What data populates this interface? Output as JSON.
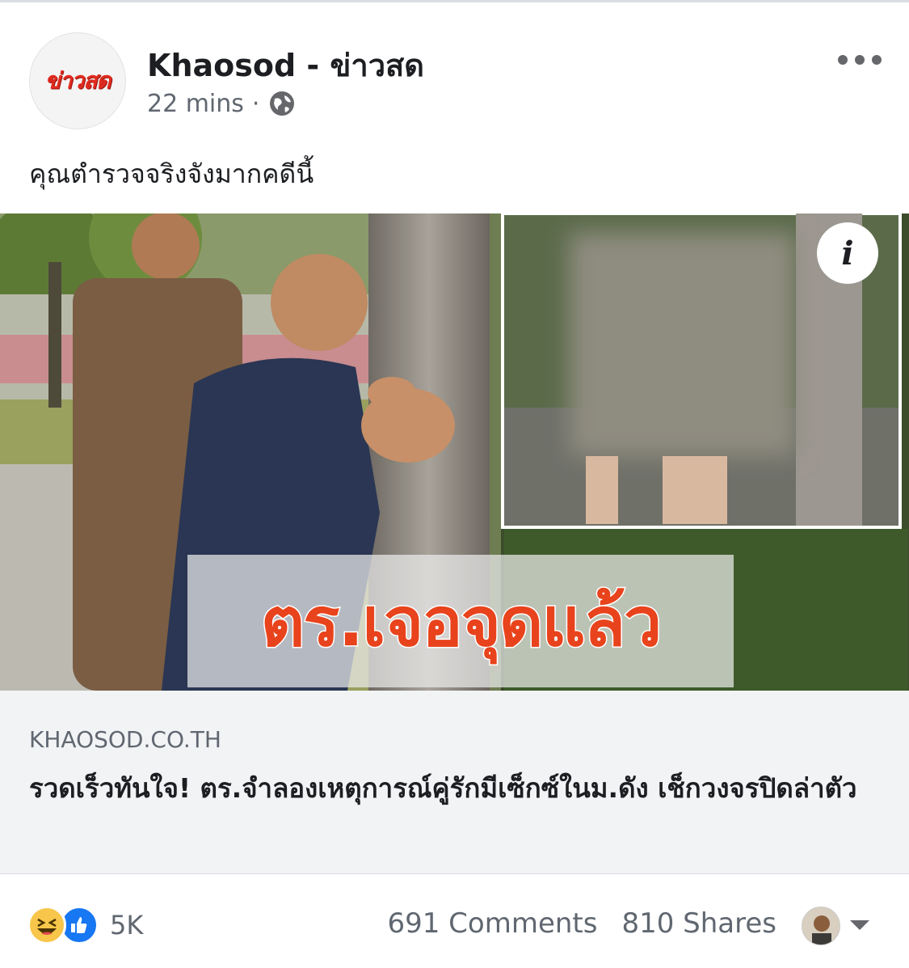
{
  "post": {
    "page_name": "Khaosod - ข่าวสด",
    "avatar_text": "ข่าวสด",
    "time": "22 mins",
    "dot": "·",
    "audience_icon": "globe-icon",
    "more_icon": "more-dots-icon",
    "caption": "คุณตำรวจจริงจังมากคดีนี้"
  },
  "image": {
    "overlay_text": "ตร.เจอจุดแล้ว",
    "info_label": "i",
    "overlay_color": "#e8431c"
  },
  "link": {
    "domain": "KHAOSOD.CO.TH",
    "title": "รวดเร็วทันใจ! ตร.จำลองเหตุการณ์คู่รักมีเซ็กซ์ในม.ดัง เช็กวงจรปิดล่าตัว"
  },
  "footer": {
    "reaction_icons": [
      "haha-icon",
      "like-icon"
    ],
    "reaction_count": "5K",
    "comments": "691 Comments",
    "shares": "810 Shares"
  },
  "colors": {
    "brand_red": "#e12b1f",
    "like_blue": "#1877f2",
    "secondary_text": "#606770"
  }
}
